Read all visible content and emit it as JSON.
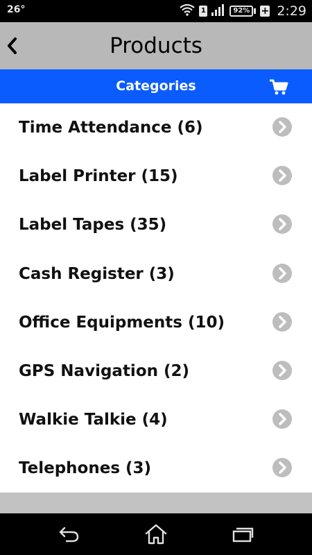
{
  "status_bar": {
    "temperature": "26°",
    "sim_label": "1",
    "battery_percent": "92%",
    "charging_symbol": "+",
    "time": "2:29",
    "icons": [
      "wifi-icon",
      "sim-icon",
      "signal-icon",
      "battery-icon",
      "charging-icon"
    ]
  },
  "header": {
    "title": "Products",
    "back_icon": "chevron-left-icon"
  },
  "categories_bar": {
    "title": "Categories",
    "cart_icon": "cart-icon",
    "background_color": "#0a5cff"
  },
  "categories": [
    {
      "label": "Time Attendance (6)"
    },
    {
      "label": "Label Printer (15)"
    },
    {
      "label": "Label Tapes (35)"
    },
    {
      "label": "Cash Register (3)"
    },
    {
      "label": "Office Equipments (10)"
    },
    {
      "label": "GPS Navigation (2)"
    },
    {
      "label": "Walkie Talkie (4)"
    },
    {
      "label": "Telephones (3)"
    }
  ],
  "navigation": {
    "buttons": [
      "back-nav-icon",
      "home-nav-icon",
      "recents-nav-icon"
    ]
  },
  "colors": {
    "header_bg": "#b8b8b8",
    "chevron_bg": "#bdbdbd",
    "footer_strip": "#c2c2c2"
  }
}
